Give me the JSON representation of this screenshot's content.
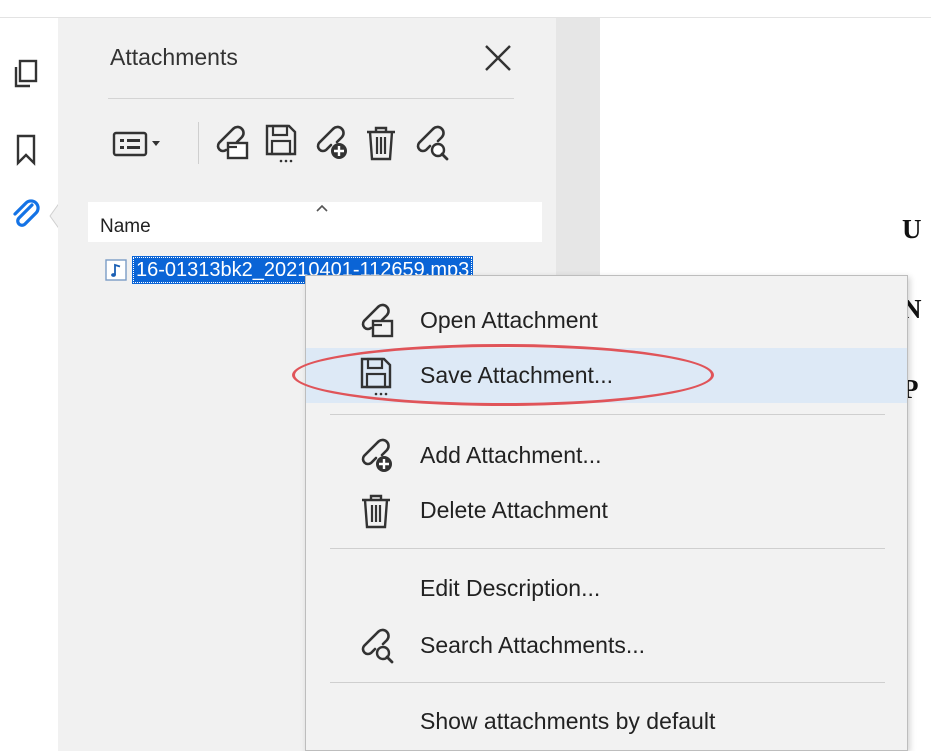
{
  "panel": {
    "title": "Attachments",
    "list_header": "Name",
    "file": {
      "name": "16-01313bk2_20210401-112659.mp3"
    }
  },
  "left_rail": {
    "icons": [
      "pages-icon",
      "bookmark-icon",
      "paperclip-icon"
    ]
  },
  "toolbar": {
    "icons": [
      "view-options-icon",
      "open-attachment-icon",
      "save-attachment-icon",
      "add-attachment-icon",
      "delete-icon",
      "search-attachment-icon"
    ]
  },
  "document": {
    "lines": [
      "U",
      "N",
      "P"
    ]
  },
  "context_menu": {
    "items": [
      {
        "label": "Open Attachment",
        "icon": "open-attachment-icon"
      },
      {
        "label": "Save Attachment...",
        "icon": "save-attachment-icon",
        "hovered": true
      },
      {
        "label": "Add Attachment...",
        "icon": "add-attachment-icon"
      },
      {
        "label": "Delete Attachment",
        "icon": "delete-icon"
      },
      {
        "label": "Edit Description..."
      },
      {
        "label": "Search Attachments...",
        "icon": "search-attachment-icon"
      },
      {
        "label": "Show attachments by default"
      }
    ]
  },
  "colors": {
    "selection": "#0a64d6",
    "hover": "#dde9f6",
    "annotation_ring": "#e05459",
    "accent_icon": "#1473e6"
  }
}
